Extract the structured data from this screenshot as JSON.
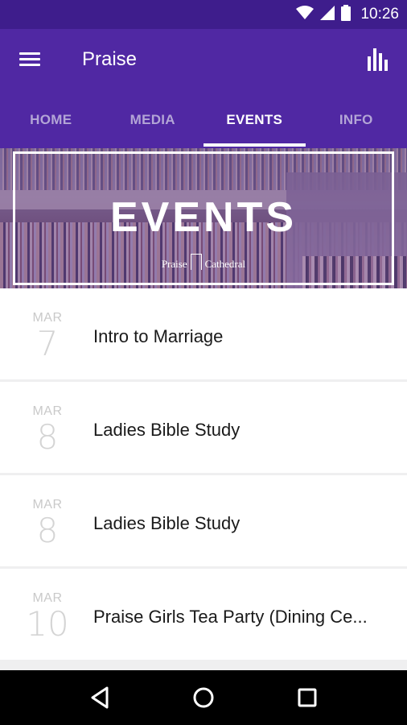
{
  "status_bar": {
    "time": "10:26",
    "icons": [
      "wifi-icon",
      "signal-icon",
      "battery-icon"
    ]
  },
  "app_bar": {
    "title": "Praise",
    "menu_icon": "menu-icon",
    "stats_icon": "bar-chart-icon"
  },
  "tabs": [
    {
      "label": "HOME",
      "active": false
    },
    {
      "label": "MEDIA",
      "active": false
    },
    {
      "label": "EVENTS",
      "active": true
    },
    {
      "label": "INFO",
      "active": false
    }
  ],
  "banner": {
    "title": "EVENTS",
    "logo_left": "Praise",
    "logo_right": "Cathedral"
  },
  "events": [
    {
      "month": "MAR",
      "day": "7",
      "title": "Intro to Marriage"
    },
    {
      "month": "MAR",
      "day": "8",
      "title": "Ladies Bible Study"
    },
    {
      "month": "MAR",
      "day": "8",
      "title": "Ladies Bible Study"
    },
    {
      "month": "MAR",
      "day": "10",
      "title": "Praise Girls Tea Party (Dining Ce..."
    }
  ],
  "nav_bar": {
    "icons": [
      "back-icon",
      "home-icon",
      "recents-icon"
    ]
  },
  "colors": {
    "status_bar": "#3e1d8c",
    "app_bar": "#5028a3",
    "tab_inactive": "#b3a5d6",
    "tab_active": "#ffffff"
  }
}
